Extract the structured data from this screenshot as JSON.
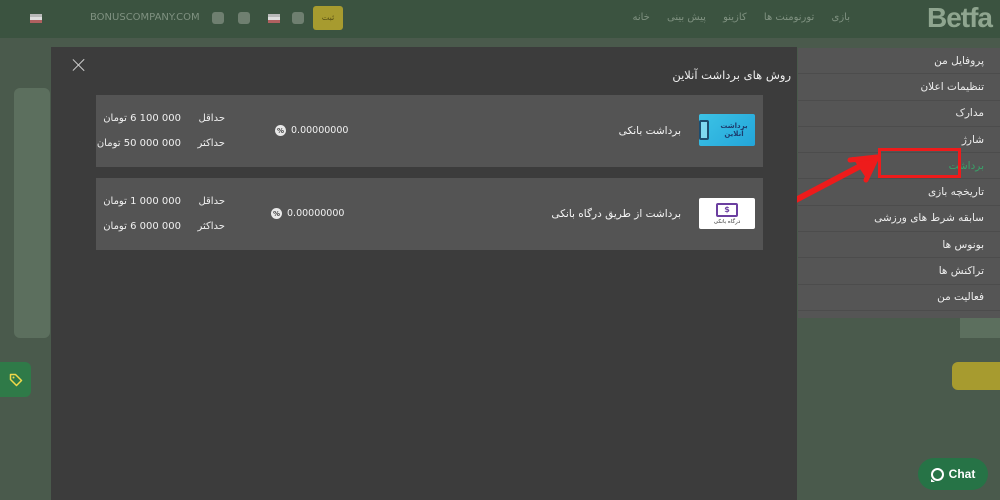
{
  "site": {
    "logo": "Betfa",
    "nav": [
      "خانه",
      "پیش بینی",
      "کازینو",
      "تورنومنت ها",
      "بازی"
    ],
    "url": "BONUSCOMPANY.COM",
    "promo_button": "ثبت"
  },
  "side_menu": {
    "items": [
      {
        "label": "پروفایل من",
        "active": false
      },
      {
        "label": "تنظیمات اعلان",
        "active": false
      },
      {
        "label": "مدارک",
        "active": false
      },
      {
        "label": "شارژ",
        "active": false
      },
      {
        "label": "برداشت",
        "active": true
      },
      {
        "label": "تاریخچه بازی",
        "active": false
      },
      {
        "label": "سابقه شرط های ورزشی",
        "active": false
      },
      {
        "label": "بونوس ها",
        "active": false
      },
      {
        "label": "تراکنش ها",
        "active": false
      },
      {
        "label": "فعالیت من",
        "active": false
      }
    ]
  },
  "modal": {
    "title": "روش های برداشت آنلاین",
    "methods": [
      {
        "name": "برداشت بانکی",
        "logo_text": "برداشت آنلاین",
        "fee": "0.00000000",
        "min_label": "حداقل",
        "min_value": "000 100 6 تومان",
        "max_label": "حداکثر",
        "max_value": "000 000 50 تومان"
      },
      {
        "name": "برداشت از طریق درگاه بانکی",
        "logo_text": "درگاه بانکی",
        "logo_symbol": "$",
        "fee": "0.00000000",
        "min_label": "حداقل",
        "min_value": "000 000 1 تومان",
        "max_label": "حداکثر",
        "max_value": "000 000 6 تومان"
      }
    ]
  },
  "chat": {
    "label": "Chat"
  },
  "colors": {
    "highlight": "#ee1b1b",
    "accent_green": "#39a269",
    "modal_bg": "#3c3c3c",
    "card_bg": "#545454"
  }
}
